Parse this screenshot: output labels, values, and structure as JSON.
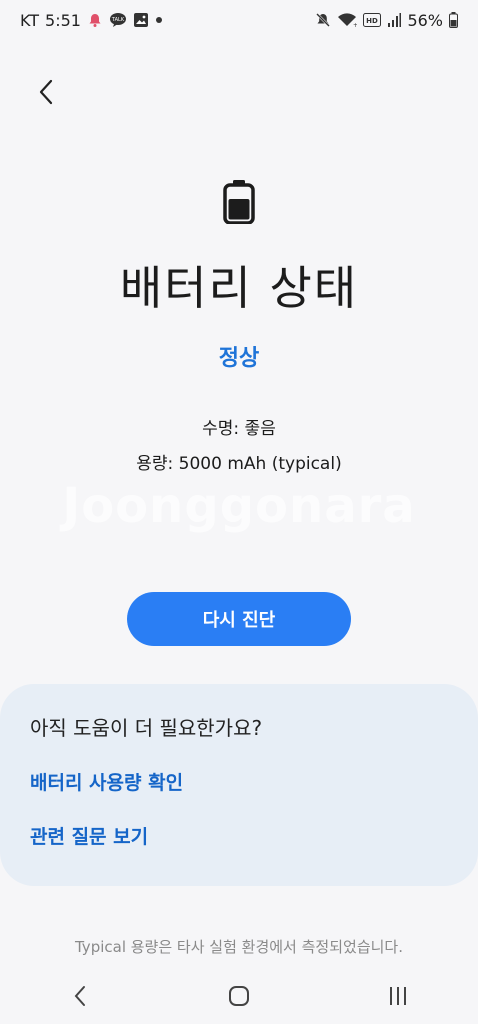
{
  "status_bar": {
    "carrier": "KT",
    "time": "5:51",
    "battery_percent": "56%",
    "left_icons": [
      "notification-bell-icon",
      "talk-message-icon",
      "gallery-icon",
      "dot-icon"
    ],
    "right_icons": [
      "mute-icon",
      "wifi-icon",
      "hd-voice-icon",
      "signal-icon",
      "battery-icon"
    ]
  },
  "header": {
    "back_icon": "chevron-left-icon"
  },
  "main": {
    "icon": "battery-icon",
    "title": "배터리 상태",
    "status": "정상",
    "lifespan": "수명: 좋음",
    "capacity": "용량: 5000 mAh (typical)",
    "watermark": "Joonggonara",
    "diagnose_button": "다시 진단",
    "accent_color": "#2a7ef4"
  },
  "help": {
    "heading": "아직 도움이 더 필요한가요?",
    "links": [
      "배터리 사용량 확인",
      "관련 질문 보기"
    ],
    "link_color": "#1565c8"
  },
  "footer": {
    "note_line1": "Typical 용량은 타사 실험 환경에서 측정되었습니다."
  },
  "nav_bar": {
    "icons": [
      "back-icon",
      "home-icon",
      "recent-apps-icon"
    ]
  }
}
